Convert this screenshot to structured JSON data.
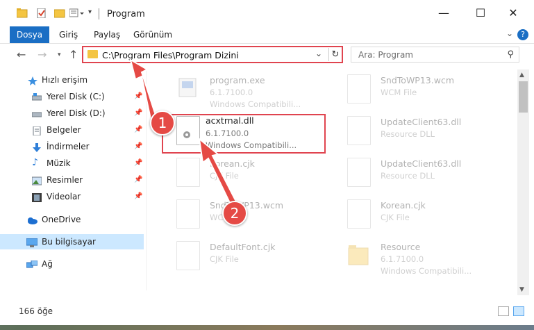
{
  "window": {
    "title": "Program"
  },
  "ribbon": {
    "tabs": [
      "Dosya",
      "Giriş",
      "Paylaş",
      "Görünüm"
    ],
    "help": "?"
  },
  "address": {
    "path": "C:\\Program Files\\Program Dizini"
  },
  "search": {
    "placeholder": "Ara: Program"
  },
  "sidebar": {
    "items": [
      {
        "label": "Hızlı erişim",
        "icon": "star-icon"
      },
      {
        "label": "Yerel Disk (C:)",
        "icon": "drive-icon"
      },
      {
        "label": "Yerel Disk (D:)",
        "icon": "drive-icon"
      },
      {
        "label": "Belgeler",
        "icon": "documents-icon"
      },
      {
        "label": "İndirmeler",
        "icon": "download-icon"
      },
      {
        "label": "Müzik",
        "icon": "music-icon"
      },
      {
        "label": "Resimler",
        "icon": "pictures-icon"
      },
      {
        "label": "Videolar",
        "icon": "video-icon"
      },
      {
        "label": "OneDrive",
        "icon": "cloud-icon"
      },
      {
        "label": "Bu bilgisayar",
        "icon": "computer-icon"
      },
      {
        "label": "Ağ",
        "icon": "network-icon"
      }
    ]
  },
  "files": [
    {
      "name": "program.exe",
      "line1": "6.1.7100.0",
      "line2": "Windows Compatibili..."
    },
    {
      "name": "SndToWP13.wcm",
      "line1": "WCM File",
      "line2": ""
    },
    {
      "name": "acxtrnal.dll",
      "line1": "6.1.7100.0",
      "line2": "Windows Compatibili..."
    },
    {
      "name": "UpdateClient63.dll",
      "line1": "Resource DLL",
      "line2": ""
    },
    {
      "name": "Korean.cjk",
      "line1": "CJK File",
      "line2": ""
    },
    {
      "name": "UpdateClient63.dll",
      "line1": "Resource DLL",
      "line2": ""
    },
    {
      "name": "SndToWP13.wcm",
      "line1": "WCM File",
      "line2": ""
    },
    {
      "name": "Korean.cjk",
      "line1": "CJK File",
      "line2": ""
    },
    {
      "name": "DefaultFont.cjk",
      "line1": "CJK File",
      "line2": ""
    },
    {
      "name": "Resource",
      "line1": "6.1.7100.0",
      "line2": "Windows Compatibili..."
    }
  ],
  "status": {
    "count": "166 öğe"
  },
  "annotations": {
    "step1": "1",
    "step2": "2",
    "color": "#e54a45"
  }
}
